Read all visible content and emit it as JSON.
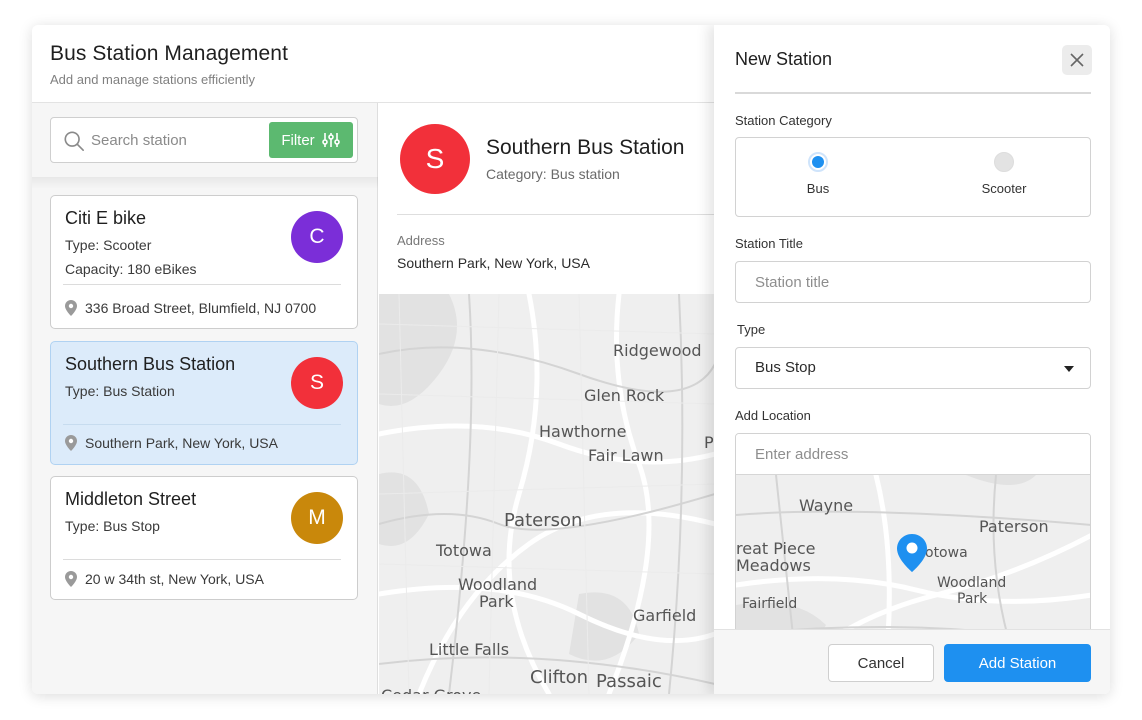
{
  "header": {
    "title": "Bus Station Management",
    "subtitle": "Add and manage stations efficiently"
  },
  "search": {
    "placeholder": "Search station",
    "filter_label": "Filter",
    "icon": "search-icon"
  },
  "stations": [
    {
      "name": "Citi E bike",
      "type": "Type: Scooter",
      "capacity": "Capacity: 180 eBikes",
      "address": "336 Broad Street, Blumfield, NJ 0700",
      "initial": "C",
      "color": "#7b2ed8",
      "active": false
    },
    {
      "name": "Southern Bus Station",
      "type": "Type: Bus Station",
      "address": "Southern Park, New York, USA",
      "initial": "S",
      "color": "#f2303a",
      "active": true
    },
    {
      "name": "Middleton Street",
      "type": "Type: Bus Stop",
      "address": "20 w 34th st, New York, USA",
      "initial": "M",
      "color": "#c9880b",
      "active": false
    }
  ],
  "detail": {
    "initial": "S",
    "title": "Southern Bus Station",
    "category": "Category: Bus station",
    "address_label": "Address",
    "address": "Southern Park, New York, USA",
    "map_labels": [
      "Ridgewood",
      "Glen Rock",
      "Hawthorne",
      "Fair Lawn",
      "Paterson",
      "Totowa",
      "Woodland",
      "Park",
      "Garfield",
      "Little Falls",
      "Clifton",
      "Passaic",
      "Cedar Grove",
      "P"
    ]
  },
  "modal": {
    "title": "New Station",
    "close_icon": "close-icon",
    "category_label": "Station Category",
    "category_options": [
      {
        "label": "Bus",
        "selected": true
      },
      {
        "label": "Scooter",
        "selected": false
      }
    ],
    "title_label": "Station Title",
    "title_placeholder": "Station title",
    "type_label": "Type",
    "type_value": "Bus Stop",
    "location_label": "Add Location",
    "location_placeholder": "Enter address",
    "mini_map_labels": [
      "Wayne",
      "Paterson",
      "reat Piece",
      "Meadows",
      "otowa",
      "Woodland",
      "Park",
      "Fairfield"
    ],
    "cancel_label": "Cancel",
    "add_label": "Add Station"
  },
  "colors": {
    "accent": "#1e90f0",
    "filter_green": "#5cb970",
    "active_card": "#dcebfa"
  }
}
